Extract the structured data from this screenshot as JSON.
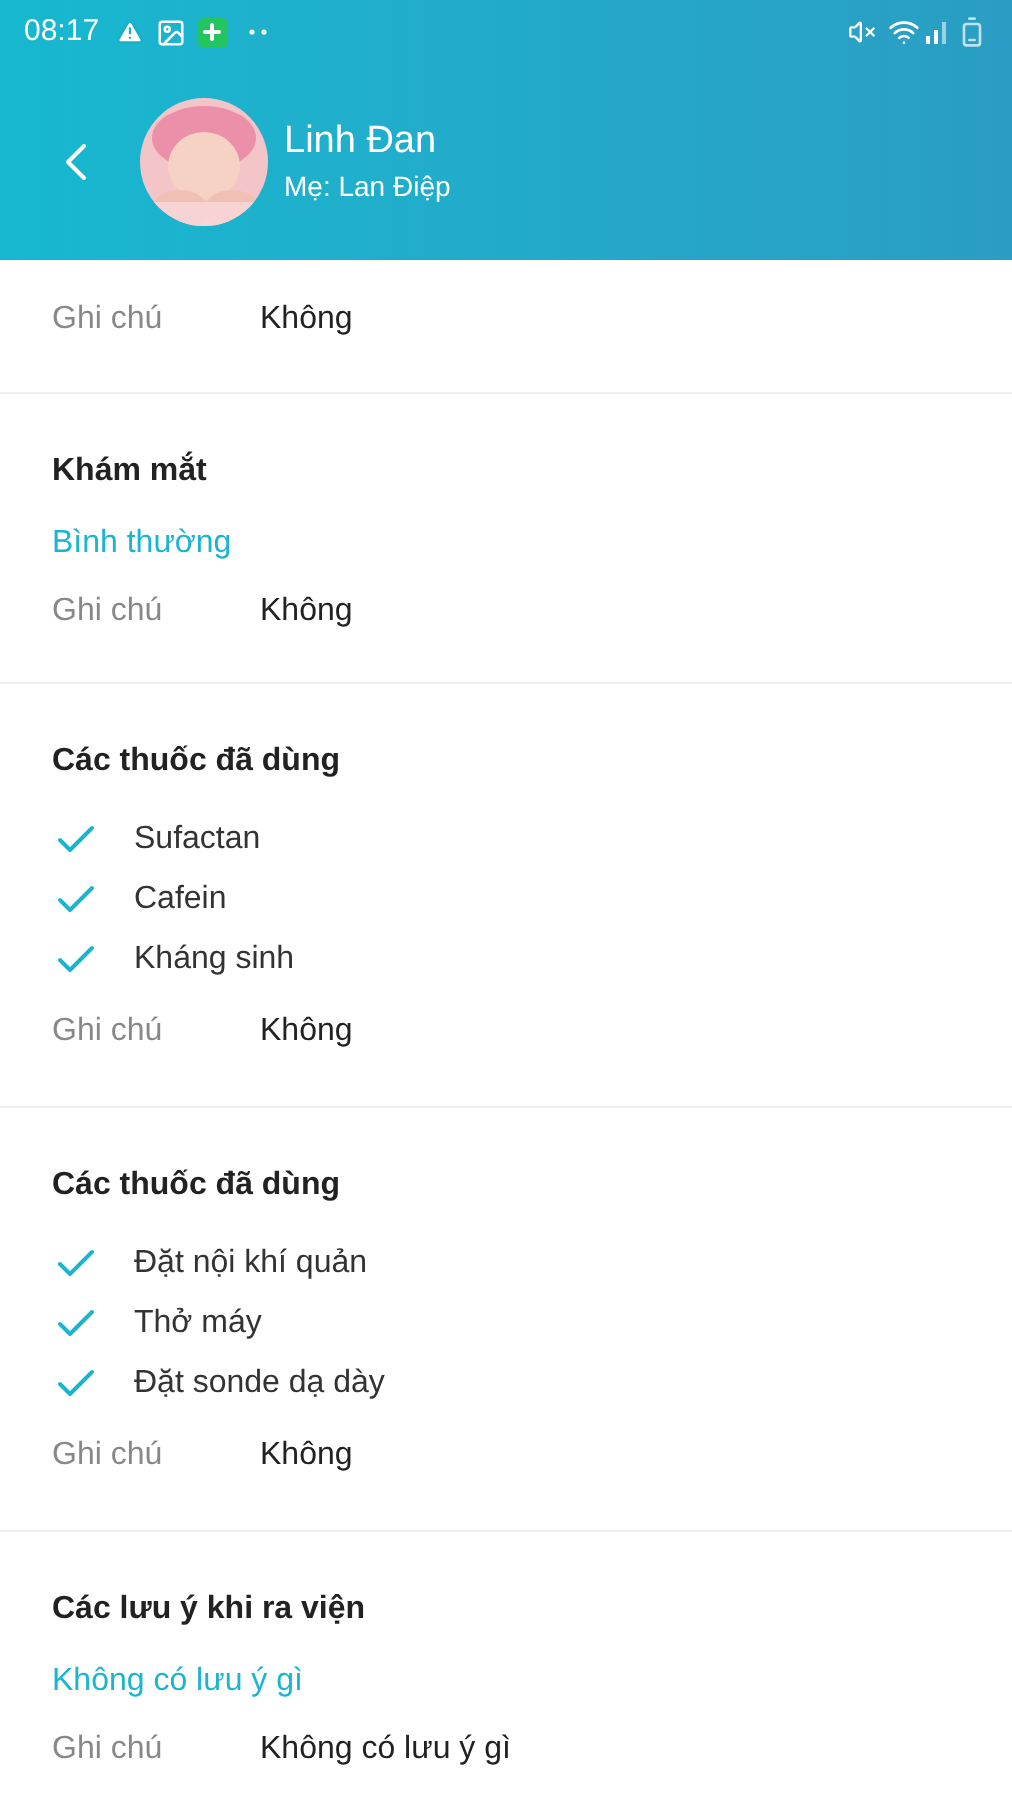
{
  "status_bar": {
    "time": "08:17"
  },
  "header": {
    "name": "Linh Đan",
    "subtitle": "Mẹ: Lan Điệp"
  },
  "sections": [
    {
      "note_label": "Ghi chú",
      "note_value": "Không"
    },
    {
      "title": "Khám mắt",
      "result": "Bình thường",
      "note_label": "Ghi chú",
      "note_value": "Không"
    },
    {
      "title": "Các thuốc đã dùng",
      "items": [
        {
          "label": "Sufactan",
          "checked": true
        },
        {
          "label": "Cafein",
          "checked": true
        },
        {
          "label": "Kháng sinh",
          "checked": true
        }
      ],
      "note_label": "Ghi chú",
      "note_value": "Không"
    },
    {
      "title": "Các thuốc đã dùng",
      "items": [
        {
          "label": "Đặt nội khí quản",
          "checked": true
        },
        {
          "label": "Thở máy",
          "checked": true
        },
        {
          "label": "Đặt sonde dạ dày",
          "checked": true
        }
      ],
      "note_label": "Ghi chú",
      "note_value": "Không"
    },
    {
      "title": "Các lưu ý khi ra viện",
      "result": "Không có lưu ý gì",
      "note_label": "Ghi chú",
      "note_value": "Không có lưu ý gì"
    }
  ]
}
